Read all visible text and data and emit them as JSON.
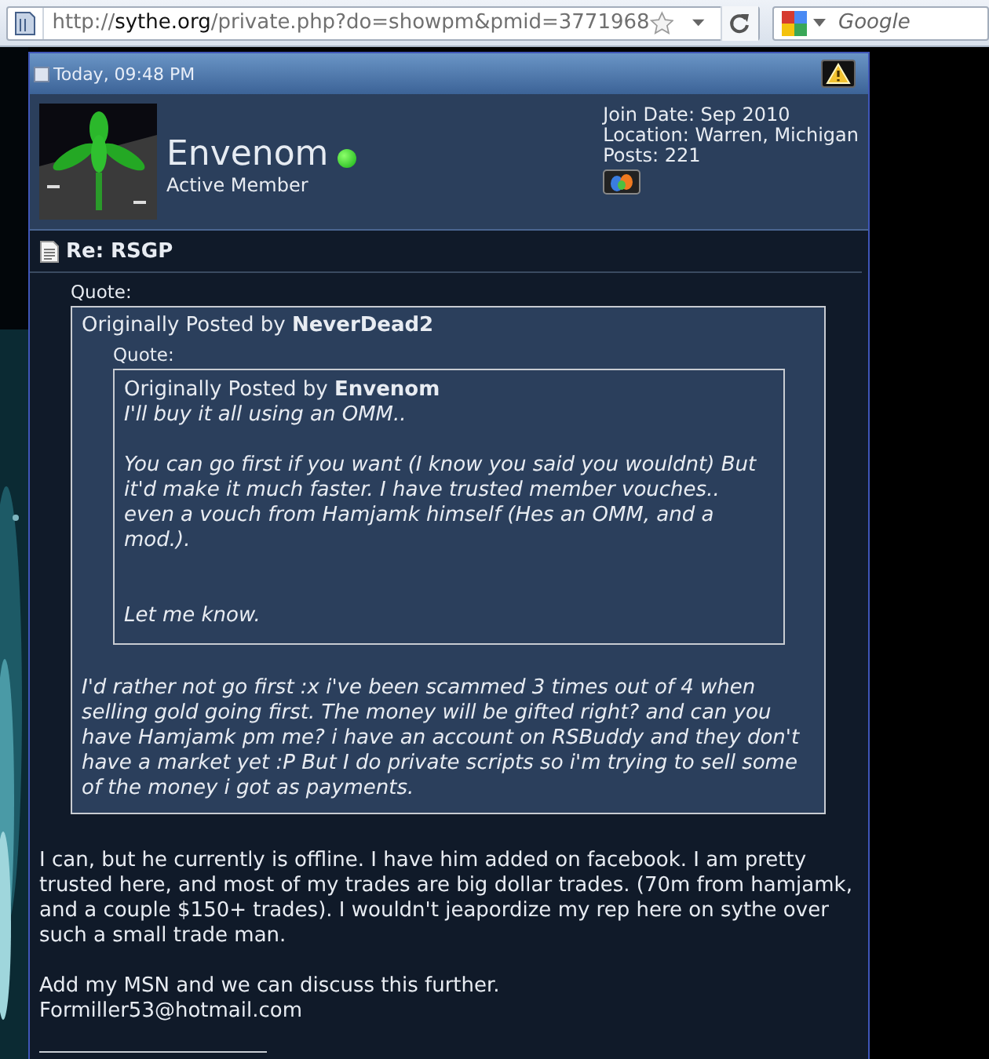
{
  "browser": {
    "url": "http://**sythe.org**/private.php?do=showpm&pmid=3771968",
    "search_placeholder": "Google"
  },
  "post": {
    "date": "Today, 09:48 PM",
    "user": {
      "name": "Envenom",
      "online": true,
      "rank": "Active Member",
      "details": [
        "Join Date: Sep 2010",
        "Location: Warren, Michigan",
        "Posts: 221"
      ]
    },
    "title": "Re: RSGP",
    "quote": {
      "label": "Quote:",
      "intro": "Originally Posted by",
      "author": "NeverDead2",
      "quote": {
        "label": "Quote:",
        "intro": "Originally Posted by",
        "author": "Envenom",
        "text": "I'll buy it all using an OMM..\n\nYou can go first if you want (I know you said you wouldnt) But it'd make it much faster. I have trusted member vouches.. even a vouch from Hamjamk himself (Hes an OMM, and a mod.).\n\n\nLet me know."
      },
      "text": "I'd rather not go first :x i've been scammed 3 times out of 4 when selling gold going first. The money will be gifted right? and can you have Hamjamk pm me? i have an account on RSBuddy and they don't have a market yet :P But I do private scripts so i'm trying to sell some of the money i got as payments."
    },
    "body": "I can, but he currently is offline. I have him added on facebook. I am pretty trusted here, and most of my trades are big dollar trades. (70m from hamjamk, and a couple $150+ trades). I wouldn't jeapordize my rep here on sythe over such a small trade man.\n\nAdd my MSN and we can discuss this further.",
    "email": "Formiller53@hotmail.com"
  }
}
